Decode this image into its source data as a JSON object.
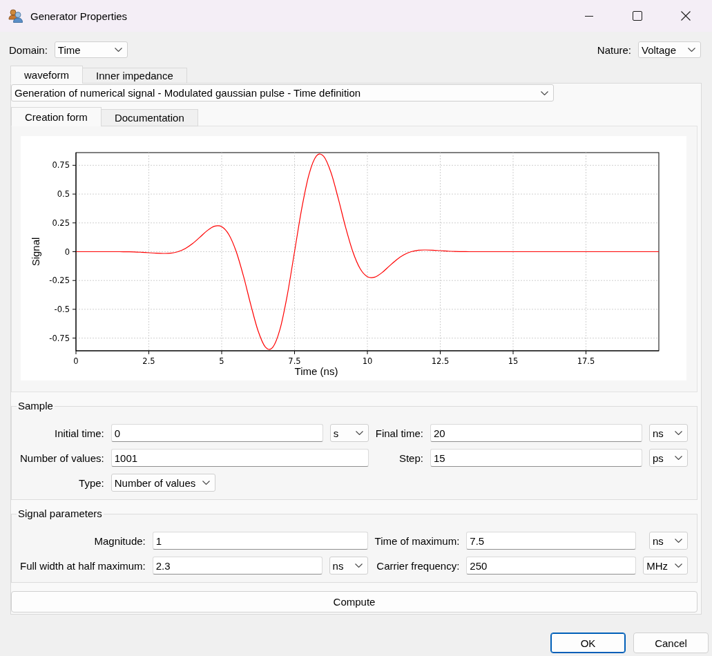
{
  "window": {
    "title": "Generator Properties"
  },
  "domain": {
    "label": "Domain:",
    "value": "Time"
  },
  "nature": {
    "label": "Nature:",
    "value": "Voltage"
  },
  "tabs": [
    {
      "label": "waveform",
      "selected": true
    },
    {
      "label": "Inner impedance",
      "selected": false
    }
  ],
  "signal_type": {
    "value": "Generation of numerical signal - Modulated gaussian pulse - Time definition"
  },
  "subtabs": [
    {
      "label": "Creation form",
      "selected": true
    },
    {
      "label": "Documentation",
      "selected": false
    }
  ],
  "chart": {
    "chart_data": {
      "type": "line",
      "xlabel": "Time (ns)",
      "ylabel": "Signal",
      "grid": true,
      "x": [
        0,
        0.25,
        0.5,
        0.75,
        1,
        1.25,
        1.5,
        1.75,
        2,
        2.25,
        2.5,
        2.75,
        3,
        3.25,
        3.5,
        3.75,
        4,
        4.25,
        4.5,
        4.75,
        5,
        5.25,
        5.5,
        5.75,
        6,
        6.25,
        6.5,
        6.75,
        7,
        7.25,
        7.5,
        7.75,
        8,
        8.25,
        8.5,
        8.75,
        9,
        9.25,
        9.5,
        9.75,
        10,
        10.25,
        10.5,
        10.75,
        11,
        11.25,
        11.5,
        11.75,
        12,
        12.25,
        12.5,
        12.75,
        13,
        13.25,
        13.5,
        13.75,
        14,
        14.25,
        14.5,
        14.75,
        15,
        15.25,
        15.5,
        15.75,
        16,
        16.25,
        16.5,
        16.75,
        17,
        17.25,
        17.5,
        17.75,
        18,
        18.25,
        18.5,
        18.75,
        19,
        19.25,
        19.5,
        19.75,
        20
      ],
      "series": [
        {
          "color": "#ff0000",
          "values": [
            0,
            0,
            0,
            0,
            0,
            0,
            0,
            -0.001,
            -0.002,
            -0.005,
            -0.009,
            -0.013,
            -0.015,
            -0.013,
            0,
            0.027,
            0.07,
            0.125,
            0.182,
            0.221,
            0.217,
            0.147,
            0,
            -0.214,
            -0.462,
            -0.688,
            -0.828,
            -0.831,
            -0.674,
            -0.378,
            0,
            0.378,
            0.674,
            0.831,
            0.828,
            0.688,
            0.462,
            0.214,
            0,
            -0.147,
            -0.217,
            -0.221,
            -0.182,
            -0.125,
            -0.07,
            -0.027,
            0,
            0.013,
            0.015,
            0.013,
            0.009,
            0.005,
            0.002,
            0.001,
            0,
            0,
            0,
            0,
            0,
            0,
            0,
            0,
            0,
            0,
            0,
            0,
            0,
            0,
            0,
            0,
            0,
            0,
            0,
            0,
            0,
            0,
            0,
            0,
            0,
            0,
            0
          ]
        }
      ],
      "xlim": [
        0,
        20
      ],
      "ylim": [
        -0.86,
        0.86
      ],
      "xticks": [
        0,
        2.5,
        5,
        7.5,
        10,
        12.5,
        15,
        17.5
      ],
      "yticks": [
        -0.75,
        -0.5,
        -0.25,
        0,
        0.25,
        0.5,
        0.75
      ]
    }
  },
  "sample": {
    "title": "Sample",
    "rows": [
      [
        {
          "kind": "text",
          "label": "Initial time:",
          "value": "0",
          "unit": "s"
        },
        {
          "kind": "text",
          "label": "Final time:",
          "value": "20",
          "unit": "ns"
        }
      ],
      [
        {
          "kind": "text",
          "label": "Number of values:",
          "value": "1001"
        },
        {
          "kind": "text",
          "label": "Step:",
          "value": "15",
          "unit": "ps"
        }
      ],
      [
        {
          "kind": "select",
          "label": "Type:",
          "value": "Number of values"
        }
      ]
    ]
  },
  "signal_parameters": {
    "title": "Signal parameters",
    "rows": [
      [
        {
          "kind": "text",
          "label": "Magnitude:",
          "value": "1"
        },
        {
          "kind": "text",
          "label": "Time of maximum:",
          "value": "7.5",
          "unit": "ns"
        }
      ],
      [
        {
          "kind": "text",
          "label": "Full width at half maximum:",
          "value": "2.3",
          "unit": "ns"
        },
        {
          "kind": "text",
          "label": "Carrier frequency:",
          "value": "250",
          "unit": "MHz"
        }
      ]
    ]
  },
  "compute_button": {
    "label": "Compute"
  },
  "buttons": [
    {
      "label": "OK",
      "default": true
    },
    {
      "label": "Cancel",
      "default": false
    }
  ]
}
